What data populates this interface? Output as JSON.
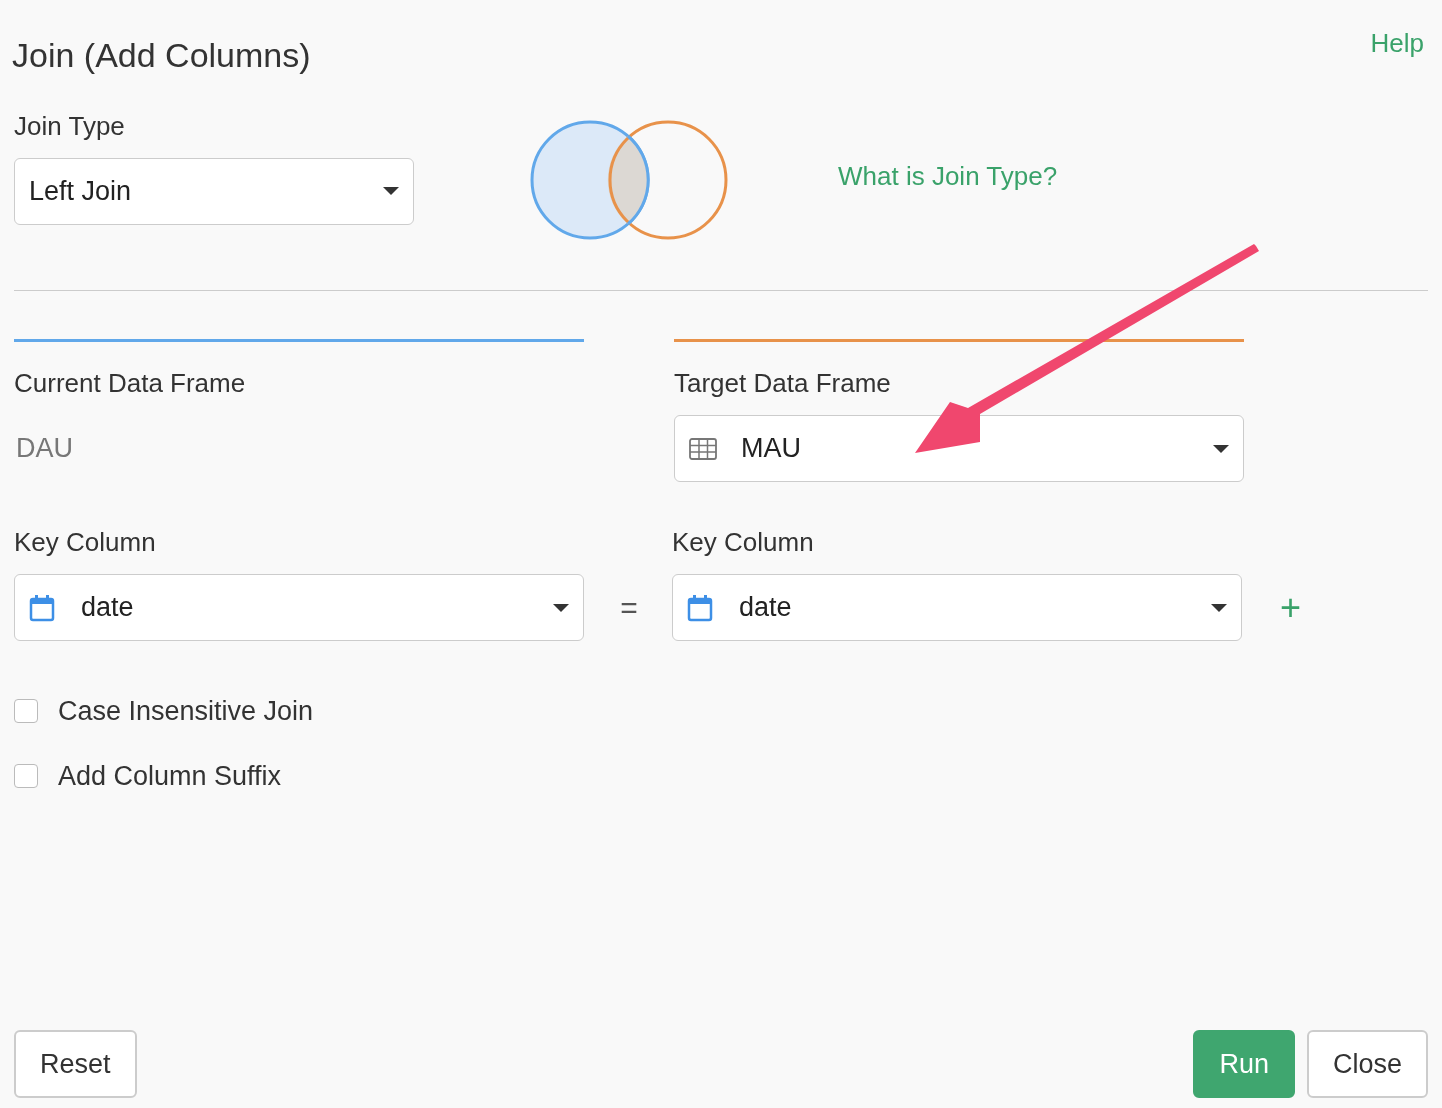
{
  "title": "Join (Add Columns)",
  "help_link": "Help",
  "join_type": {
    "label": "Join Type",
    "value": "Left Join",
    "help_link": "What is Join Type?"
  },
  "current": {
    "heading": "Current Data Frame",
    "value": "DAU"
  },
  "target": {
    "heading": "Target Data Frame",
    "value": "MAU"
  },
  "key_columns": [
    {
      "label": "Key Column",
      "value": "date"
    },
    {
      "label": "Key Column",
      "value": "date"
    }
  ],
  "equals": "=",
  "add": "+",
  "options": [
    {
      "label": "Case Insensitive Join",
      "checked": false
    },
    {
      "label": "Add Column Suffix",
      "checked": false
    }
  ],
  "buttons": [
    {
      "label": "Reset",
      "kind": "default"
    },
    {
      "label": "Run",
      "kind": "primary"
    },
    {
      "label": "Close",
      "kind": "default"
    }
  ]
}
